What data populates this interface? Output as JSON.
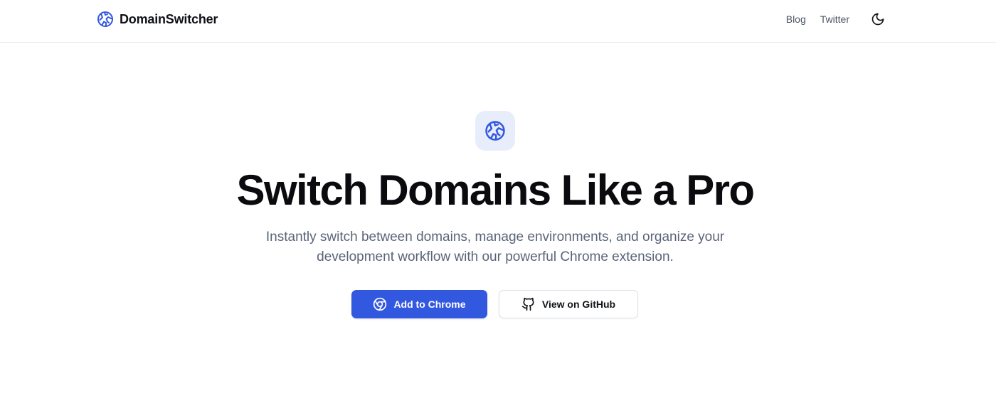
{
  "header": {
    "brand_name": "DomainSwitcher",
    "brand_icon": "globe-icon",
    "nav": [
      {
        "label": "Blog"
      },
      {
        "label": "Twitter"
      }
    ],
    "theme_toggle_icon": "moon-icon"
  },
  "hero": {
    "badge_icon": "globe-icon",
    "title": "Switch Domains Like a Pro",
    "subtitle_lines": [
      "Instantly switch between domains, manage environments, and organize your",
      "development workflow with our powerful Chrome extension."
    ],
    "primary_button": {
      "label": "Add to Chrome",
      "icon": "chrome-icon"
    },
    "secondary_button": {
      "label": "View on GitHub",
      "icon": "github-icon"
    }
  },
  "colors": {
    "accent": "#3358e0",
    "badge_background": "#e8edfb",
    "muted_text": "#5a6478"
  }
}
